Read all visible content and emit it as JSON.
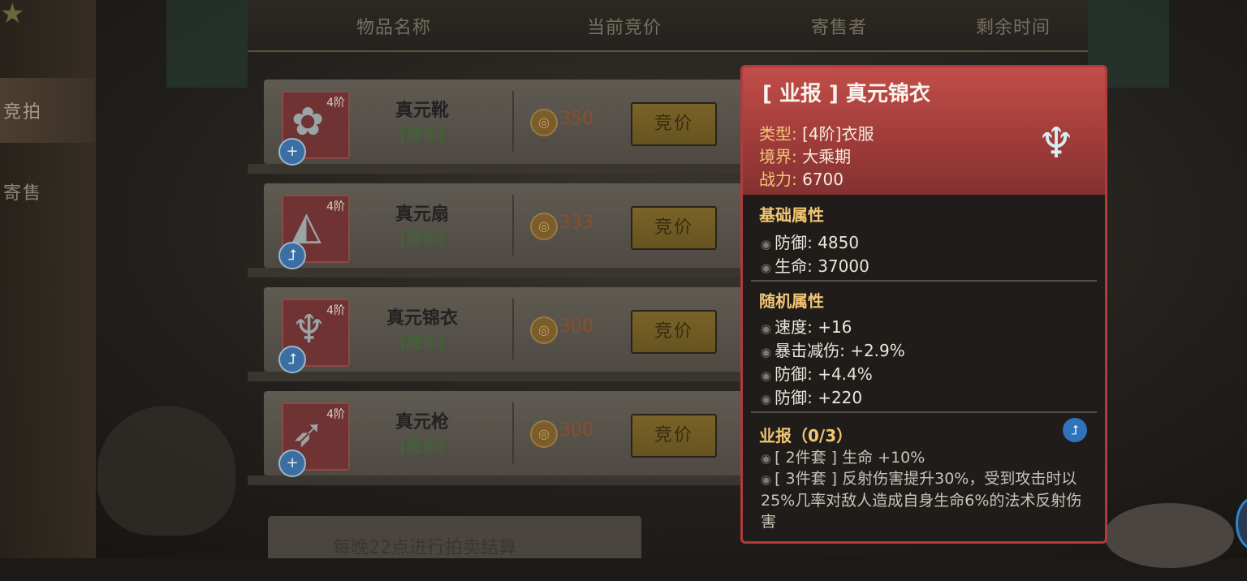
{
  "header": {
    "col_name": "物品名称",
    "col_bid": "当前竞价",
    "col_seller": "寄售者",
    "col_time": "剩余时间"
  },
  "left_nav": [
    {
      "label": "竞拍"
    },
    {
      "label": "寄售"
    }
  ],
  "rows": [
    {
      "name": "真元靴",
      "tag": "[底价]",
      "tier": "4阶",
      "bid": "350",
      "button": "竞价"
    },
    {
      "name": "真元扇",
      "tag": "[底价]",
      "tier": "4阶",
      "bid": "333",
      "button": "竞价"
    },
    {
      "name": "真元锦衣",
      "tag": "[底价]",
      "tier": "4阶",
      "bid": "300",
      "button": "竞价"
    },
    {
      "name": "真元枪",
      "tag": "[底价]",
      "tier": "4阶",
      "bid": "300",
      "button": "竞价"
    }
  ],
  "footer_note": "每晚22点进行拍卖结算",
  "tooltip": {
    "title": "[ 业报 ] 真元锦衣",
    "type_key": "类型:",
    "type_val": "[4阶]衣服",
    "realm_key": "境界:",
    "realm_val": "大乘期",
    "power_key": "战力:",
    "power_val": "6700",
    "base_title": "基础属性",
    "base_stats": [
      "防御: 4850",
      "生命: 37000"
    ],
    "random_title": "随机属性",
    "random_stats": [
      "速度: +16",
      "暴击减伤: +2.9%",
      "防御: +4.4%",
      "防御: +220"
    ],
    "set_title": "业报（0/3）",
    "set_lines": [
      "[ 2件套 ] 生命 +10%",
      "[ 3件套 ] 反射伤害提升30%，受到攻击时以25%几率对敌人造成自身生命6%的法术反射伤害"
    ]
  },
  "colors": {
    "tooltip_border": "#b23a3a",
    "tooltip_header": "#c14e4a",
    "gold_text": "#f1c673"
  }
}
